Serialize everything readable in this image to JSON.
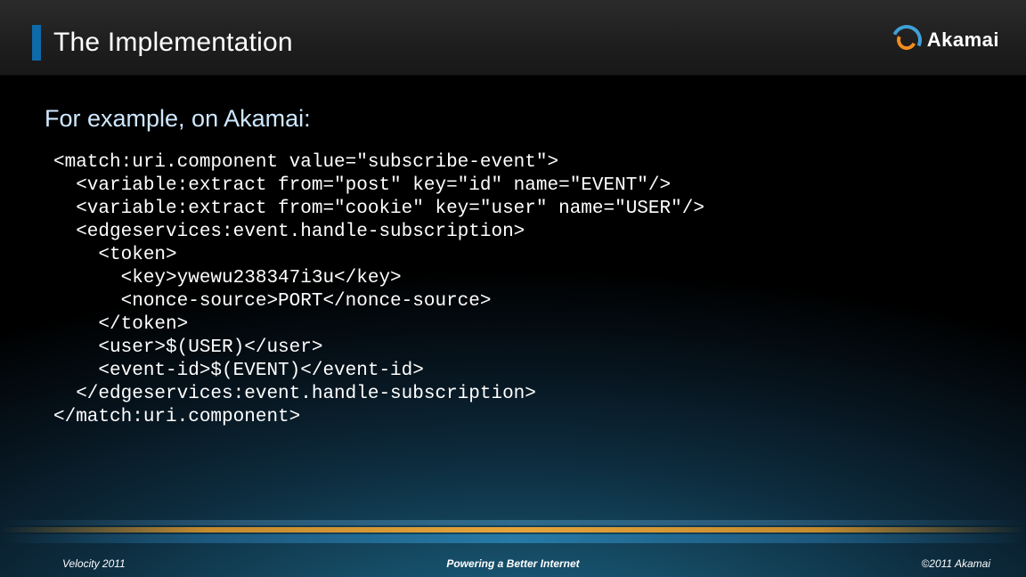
{
  "header": {
    "title": "The Implementation",
    "logo_text": "Akamai"
  },
  "content": {
    "subtitle": "For example, on Akamai:",
    "code_lines": [
      "<match:uri.component value=\"subscribe-event\">",
      "  <variable:extract from=\"post\" key=\"id\" name=\"EVENT\"/>",
      "  <variable:extract from=\"cookie\" key=\"user\" name=\"USER\"/>",
      "  <edgeservices:event.handle-subscription>",
      "    <token>",
      "      <key>ywewu238347i3u</key>",
      "      <nonce-source>PORT</nonce-source>",
      "    </token>",
      "    <user>$(USER)</user>",
      "    <event-id>$(EVENT)</event-id>",
      "  </edgeservices:event.handle-subscription>",
      "</match:uri.component>"
    ]
  },
  "footer": {
    "left": "Velocity 2011",
    "center": "Powering a Better Internet",
    "right": "©2011 Akamai"
  }
}
